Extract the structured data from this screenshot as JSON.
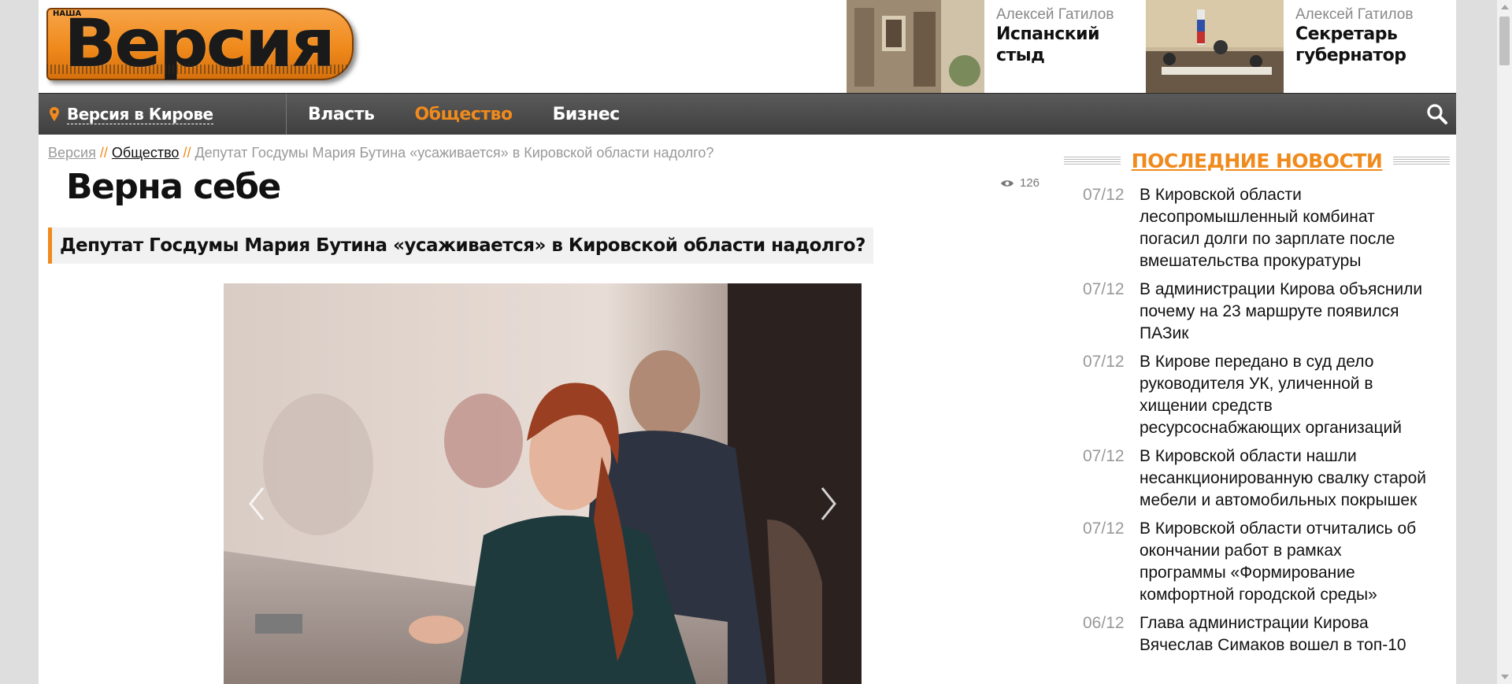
{
  "header": {
    "logo_small": "НАША",
    "logo_text": "Версия",
    "promos": [
      {
        "author": "Алексей Гатилов",
        "title": "Испанский стыд"
      },
      {
        "author": "Алексей Гатилов",
        "title": "Секретарь губернатор"
      }
    ]
  },
  "nav": {
    "region": "Версия в Кирове",
    "items": [
      "Власть",
      "Общество",
      "Бизнес"
    ],
    "active": "Общество"
  },
  "breadcrumb": {
    "home": "Версия",
    "section": "Общество",
    "current": "Депутат Госдумы Мария Бутина «усаживается» в Кировской области надолго?",
    "sep": "//"
  },
  "article": {
    "title": "Верна себе",
    "views": "126",
    "lead": "Депутат Госдумы Мария Бутина «усаживается» в Кировской области надолго?"
  },
  "sidebar": {
    "title": "ПОСЛЕДНИЕ НОВОСТИ",
    "news": [
      {
        "date": "07/12",
        "title": "В Кировской области лесопромышленный комбинат погасил долги по зарплате после вмешательства прокуратуры"
      },
      {
        "date": "07/12",
        "title": "В администрации Кирова объяснили почему на 23 маршруте появился ПАЗик"
      },
      {
        "date": "07/12",
        "title": "В Кирове передано в суд дело руководителя УК, уличенной в хищении средств ресурсоснабжающих организаций"
      },
      {
        "date": "07/12",
        "title": "В Кировской области нашли несанкционированную свалку старой мебели и автомобильных покрышек"
      },
      {
        "date": "07/12",
        "title": "В Кировской области отчитались об окончании работ в рамках программы «Формирование комфортной городской среды»"
      },
      {
        "date": "06/12",
        "title": "Глава администрации Кирова Вячеслав Симаков вошел в топ-10"
      }
    ]
  },
  "colors": {
    "accent": "#f08a1c",
    "nav_bg": "#4a4a4a"
  }
}
